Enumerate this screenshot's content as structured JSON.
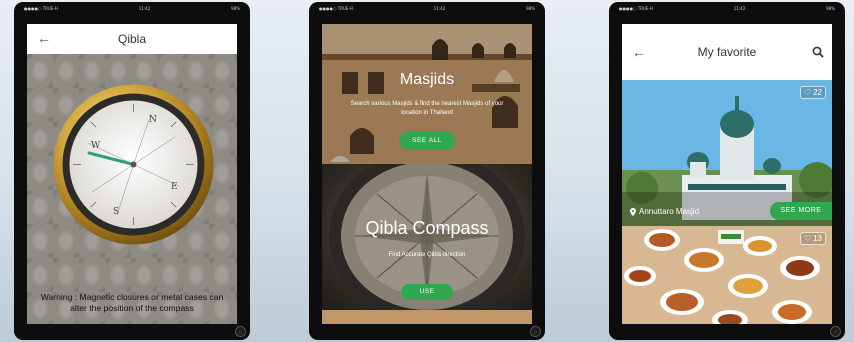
{
  "status_bar": {
    "carrier": "●●●●○ TRUE-H",
    "time": "11:42",
    "battery": "98%"
  },
  "screen_qibla": {
    "title": "Qibla",
    "back_glyph": "←",
    "warning": "Warning : Magnetic closures or metal cases can alter the position of the compass"
  },
  "screen_home": {
    "masjids_title": "Masjids",
    "masjids_subtitle": "Search various Masjids & find the nearest Masjids of your location in Thailand",
    "masjids_button": "SEE ALL",
    "compass_title": "Qibla Compass",
    "compass_subtitle": "Find Accurate Qibla direction",
    "compass_button": "USE"
  },
  "screen_favorite": {
    "title": "My favorite",
    "back_glyph": "←",
    "card1": {
      "likes": "22",
      "place": "Annuttaro Masjid",
      "button": "SEE MORE"
    },
    "card2": {
      "likes": "13"
    }
  },
  "icons": [
    "back-arrow-icon",
    "search-icon",
    "heart-icon",
    "location-pin-icon",
    "home-button-icon"
  ],
  "colors": {
    "accent_green": "#2fa84f",
    "compass_needle": "#2f9e7f",
    "gold_bezel": "#c9a23a"
  }
}
